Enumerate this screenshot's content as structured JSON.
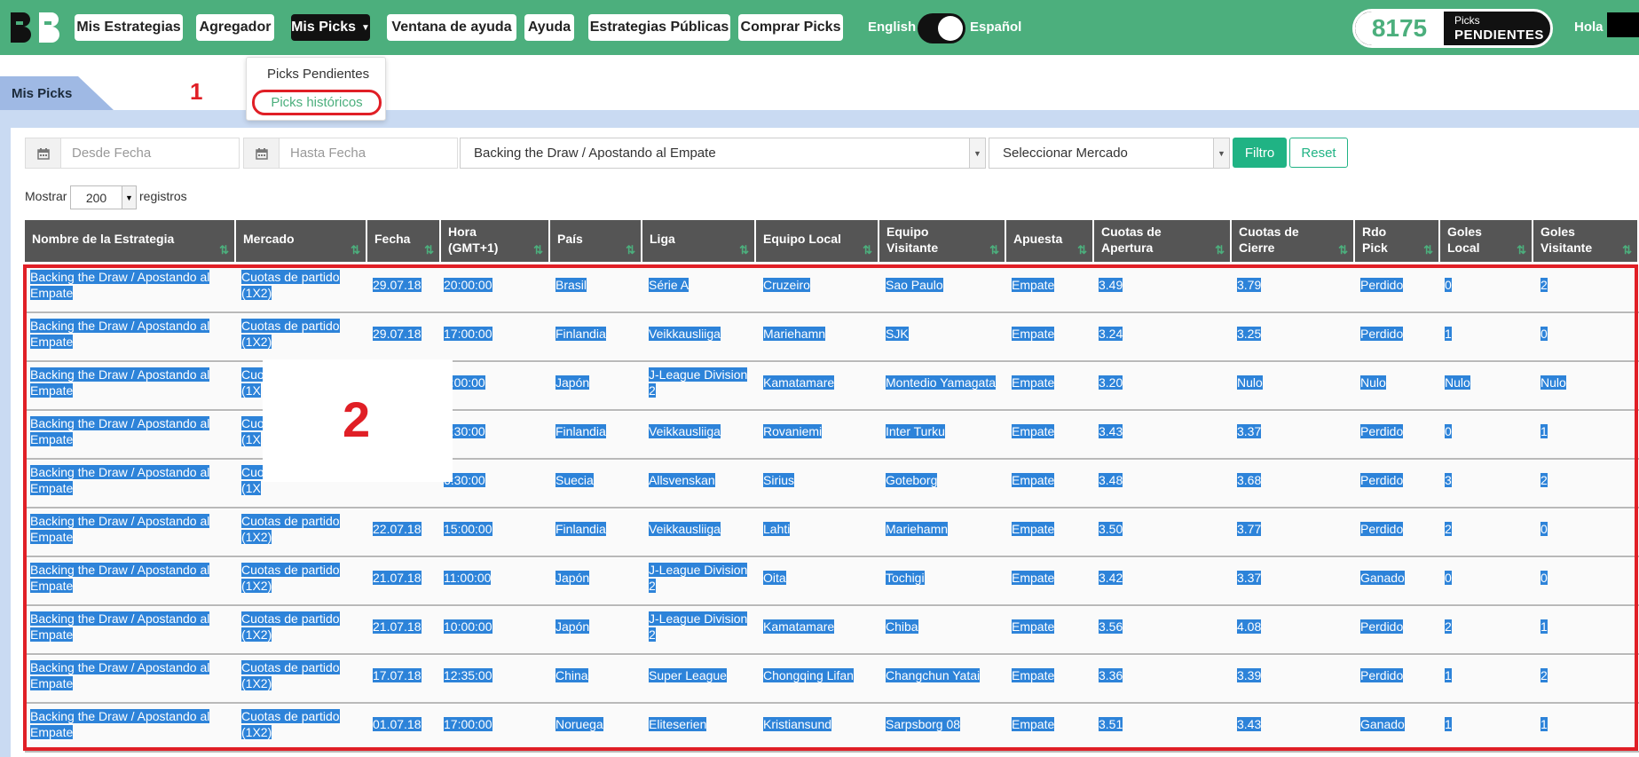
{
  "header": {
    "nav": [
      {
        "label": "Mis Estrategias"
      },
      {
        "label": "Agregador"
      },
      {
        "label": "Mis Picks"
      },
      {
        "label": "Ventana de ayuda"
      },
      {
        "label": "Ayuda"
      },
      {
        "label": "Estrategias Públicas"
      },
      {
        "label": "Comprar Picks"
      }
    ],
    "lang_en": "English",
    "lang_es": "Español",
    "pending_count": "8175",
    "pending_label1": "Picks",
    "pending_label2": "PENDIENTES",
    "greeting": "Hola"
  },
  "dropdown": {
    "item1": "Picks Pendientes",
    "item2": "Picks históricos"
  },
  "tab": {
    "label": "Mis Picks"
  },
  "annotations": {
    "step1": "1",
    "step2": "2"
  },
  "filters": {
    "from_placeholder": "Desde Fecha",
    "to_placeholder": "Hasta Fecha",
    "strategy_value": "Backing the Draw / Apostando al Empate",
    "market_value": "Seleccionar Mercado",
    "filter_button": "Filtro",
    "reset_button": "Reset"
  },
  "length": {
    "prefix": "Mostrar",
    "value": "200",
    "suffix": "registros"
  },
  "table": {
    "columns": [
      {
        "l1": "Nombre de la Estrategia",
        "l2": ""
      },
      {
        "l1": "Mercado",
        "l2": ""
      },
      {
        "l1": "Fecha",
        "l2": ""
      },
      {
        "l1": "Hora",
        "l2": "(GMT+1)"
      },
      {
        "l1": "País",
        "l2": ""
      },
      {
        "l1": "Liga",
        "l2": ""
      },
      {
        "l1": "Equipo Local",
        "l2": ""
      },
      {
        "l1": "Equipo",
        "l2": "Visitante"
      },
      {
        "l1": "Apuesta",
        "l2": ""
      },
      {
        "l1": "Cuotas de",
        "l2": "Apertura"
      },
      {
        "l1": "Cuotas de",
        "l2": "Cierre"
      },
      {
        "l1": "Rdo",
        "l2": "Pick"
      },
      {
        "l1": "Goles",
        "l2": "Local"
      },
      {
        "l1": "Goles",
        "l2": "Visitante"
      }
    ],
    "rows": [
      {
        "strategy1": "Backing the Draw / Apostando al",
        "strategy2": "Empate",
        "market1": "Cuotas de partido",
        "market2": "(1X2)",
        "date": "29.07.18",
        "time": "20:00:00",
        "country": "Brasil",
        "league1": "Série A",
        "league2": "",
        "home": "Cruzeiro",
        "away": "Sao Paulo",
        "bet": "Empate",
        "open": "3.49",
        "close": "3.79",
        "result": "Perdido",
        "gh": "0",
        "ga": "2"
      },
      {
        "strategy1": "Backing the Draw / Apostando al",
        "strategy2": "Empate",
        "market1": "Cuotas de partido",
        "market2": "(1X2)",
        "date": "29.07.18",
        "time": "17:00:00",
        "country": "Finlandia",
        "league1": "Veikkausliiga",
        "league2": "",
        "home": "Mariehamn",
        "away": "SJK",
        "bet": "Empate",
        "open": "3.24",
        "close": "3.25",
        "result": "Perdido",
        "gh": "1",
        "ga": "0"
      },
      {
        "strategy1": "Backing the Draw / Apostando al",
        "strategy2": "Empate",
        "market1": "Cuo",
        "market2": "(1X",
        "date": "",
        "time": "0:00:00",
        "country": "Japón",
        "league1": "J-League Division",
        "league2": "2",
        "home": "Kamatamare",
        "away": "Montedio Yamagata",
        "bet": "Empate",
        "open": "3.20",
        "close": "Nulo",
        "result": "Nulo",
        "gh": "Nulo",
        "ga": "Nulo"
      },
      {
        "strategy1": "Backing the Draw / Apostando al",
        "strategy2": "Empate",
        "market1": "Cuo",
        "market2": "(1X",
        "date": "",
        "time": "6:30:00",
        "country": "Finlandia",
        "league1": "Veikkausliiga",
        "league2": "",
        "home": "Rovaniemi",
        "away": "Inter Turku",
        "bet": "Empate",
        "open": "3.43",
        "close": "3.37",
        "result": "Perdido",
        "gh": "0",
        "ga": "1"
      },
      {
        "strategy1": "Backing the Draw / Apostando al",
        "strategy2": "Empate",
        "market1": "Cuo",
        "market2": "(1X",
        "date": "",
        "time": "6:30:00",
        "country": "Suecia",
        "league1": "Allsvenskan",
        "league2": "",
        "home": "Sirius",
        "away": "Goteborg",
        "bet": "Empate",
        "open": "3.48",
        "close": "3.68",
        "result": "Perdido",
        "gh": "3",
        "ga": "2"
      },
      {
        "strategy1": "Backing the Draw / Apostando al",
        "strategy2": "Empate",
        "market1": "Cuotas de partido",
        "market2": "(1X2)",
        "date": "22.07.18",
        "time": "15:00:00",
        "country": "Finlandia",
        "league1": "Veikkausliiga",
        "league2": "",
        "home": "Lahti",
        "away": "Mariehamn",
        "bet": "Empate",
        "open": "3.50",
        "close": "3.77",
        "result": "Perdido",
        "gh": "2",
        "ga": "0"
      },
      {
        "strategy1": "Backing the Draw / Apostando al",
        "strategy2": "Empate",
        "market1": "Cuotas de partido",
        "market2": "(1X2)",
        "date": "21.07.18",
        "time": "11:00:00",
        "country": "Japón",
        "league1": "J-League Division",
        "league2": "2",
        "home": "Oita",
        "away": "Tochigi",
        "bet": "Empate",
        "open": "3.42",
        "close": "3.37",
        "result": "Ganado",
        "gh": "0",
        "ga": "0"
      },
      {
        "strategy1": "Backing the Draw / Apostando al",
        "strategy2": "Empate",
        "market1": "Cuotas de partido",
        "market2": "(1X2)",
        "date": "21.07.18",
        "time": "10:00:00",
        "country": "Japón",
        "league1": "J-League Division",
        "league2": "2",
        "home": "Kamatamare",
        "away": "Chiba",
        "bet": "Empate",
        "open": "3.56",
        "close": "4.08",
        "result": "Perdido",
        "gh": "2",
        "ga": "1"
      },
      {
        "strategy1": "Backing the Draw / Apostando al",
        "strategy2": "Empate",
        "market1": "Cuotas de partido",
        "market2": "(1X2)",
        "date": "17.07.18",
        "time": "12:35:00",
        "country": "China",
        "league1": "Super League",
        "league2": "",
        "home": "Chongqing Lifan",
        "away": "Changchun Yatai",
        "bet": "Empate",
        "open": "3.36",
        "close": "3.39",
        "result": "Perdido",
        "gh": "1",
        "ga": "2"
      },
      {
        "strategy1": "Backing the Draw / Apostando al",
        "strategy2": "Empate",
        "market1": "Cuotas de partido",
        "market2": "(1X2)",
        "date": "01.07.18",
        "time": "17:00:00",
        "country": "Noruega",
        "league1": "Eliteserien",
        "league2": "",
        "home": "Kristiansund",
        "away": "Sarpsborg 08",
        "bet": "Empate",
        "open": "3.51",
        "close": "3.43",
        "result": "Ganado",
        "gh": "1",
        "ga": "1"
      }
    ]
  },
  "colors": {
    "brand_green": "#4caf7d",
    "selection_blue": "#2d83d9",
    "annotation_red": "#e01f26"
  }
}
